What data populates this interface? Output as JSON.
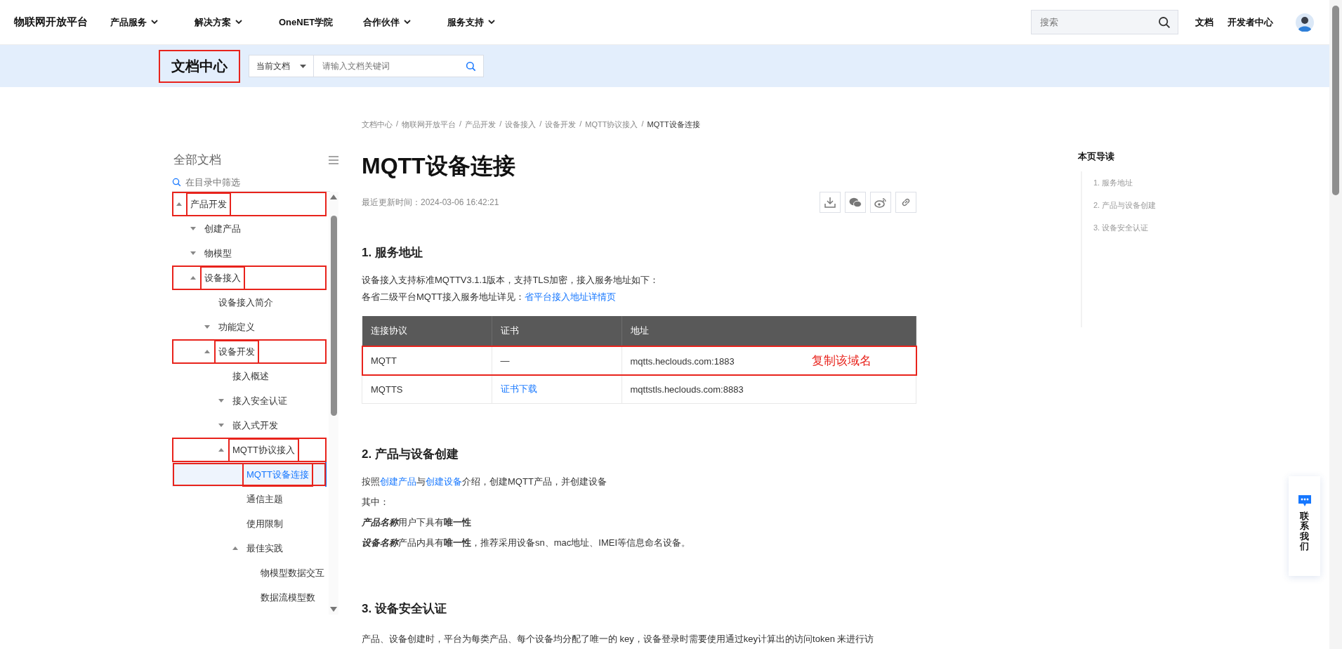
{
  "header": {
    "logo": "物联网开放平台",
    "nav": [
      {
        "label": "产品服务",
        "dropdown": true
      },
      {
        "label": "解决方案",
        "dropdown": true
      },
      {
        "label": "OneNET学院",
        "dropdown": false
      },
      {
        "label": "合作伙伴",
        "dropdown": true
      },
      {
        "label": "服务支持",
        "dropdown": true
      }
    ],
    "search": {
      "placeholder": "搜索"
    },
    "links": [
      "文档",
      "开发者中心"
    ]
  },
  "doc_bar": {
    "title": "文档中心",
    "annotated": true,
    "scope": "当前文档",
    "search": {
      "placeholder": "请输入文档关键词"
    }
  },
  "sidebar": {
    "title": "全部文档",
    "filter": {
      "placeholder": "在目录中筛选"
    },
    "tree": [
      {
        "label": "产品开发",
        "expanded": true,
        "selected": false,
        "annotated": true,
        "children": [
          {
            "label": "创建产品",
            "expanded": false,
            "selected": false,
            "annotated": false
          },
          {
            "label": "物模型",
            "expanded": false,
            "selected": false,
            "annotated": false
          },
          {
            "label": "设备接入",
            "expanded": true,
            "selected": false,
            "annotated": true,
            "children": [
              {
                "label": "设备接入简介",
                "selected": false,
                "annotated": false
              },
              {
                "label": "功能定义",
                "expanded": false,
                "selected": false,
                "annotated": false
              },
              {
                "label": "设备开发",
                "expanded": true,
                "selected": false,
                "annotated": true,
                "children": [
                  {
                    "label": "接入概述",
                    "selected": false,
                    "annotated": false
                  },
                  {
                    "label": "接入安全认证",
                    "expanded": false,
                    "selected": false,
                    "annotated": false
                  },
                  {
                    "label": "嵌入式开发",
                    "expanded": false,
                    "selected": false,
                    "annotated": false
                  },
                  {
                    "label": "MQTT协议接入",
                    "expanded": true,
                    "selected": false,
                    "annotated": true,
                    "children": [
                      {
                        "label": "MQTT设备连接",
                        "selected": true,
                        "annotated": true
                      },
                      {
                        "label": "通信主题",
                        "selected": false,
                        "annotated": false
                      },
                      {
                        "label": "使用限制",
                        "selected": false,
                        "annotated": false
                      },
                      {
                        "label": "最佳实践",
                        "expanded": true,
                        "selected": false,
                        "annotated": false,
                        "children": [
                          {
                            "label": "物模型数据交互",
                            "selected": false,
                            "annotated": false
                          },
                          {
                            "label": "数据流模型数",
                            "selected": false,
                            "annotated": false
                          }
                        ]
                      }
                    ]
                  }
                ]
              }
            ]
          }
        ]
      }
    ]
  },
  "breadcrumb_separator": "/",
  "breadcrumb": [
    "文档中心",
    "物联网开放平台",
    "产品开发",
    "设备接入",
    "设备开发",
    "MQTT协议接入",
    "MQTT设备连接"
  ],
  "article": {
    "title": "MQTT设备连接",
    "updated": "最近更新时间：2024-03-06 16:42:21",
    "sections": [
      {
        "heading": "1. 服务地址",
        "blocks": [
          {
            "kind": "para",
            "lines": [
              [
                {
                  "text": "设备接入支持标准MQTTV3.1.1版本，支持TLS加密，接入服务地址如下："
                }
              ],
              [
                {
                  "text": "各省二级平台MQTT接入服务地址详见："
                },
                {
                  "text": "省平台接入地址详情页",
                  "link": true
                }
              ]
            ]
          },
          {
            "kind": "table",
            "columns": [
              "连接协议",
              "证书",
              "地址"
            ],
            "rows": [
              {
                "cells": [
                  {
                    "text": "MQTT"
                  },
                  {
                    "text": "—"
                  },
                  {
                    "text": "mqtts.heclouds.com:1883"
                  }
                ],
                "annotated": true,
                "annotation": "复制该域名"
              },
              {
                "cells": [
                  {
                    "text": "MQTTS"
                  },
                  {
                    "text": "证书下载",
                    "link": true
                  },
                  {
                    "text": "mqttstls.heclouds.com:8883"
                  }
                ],
                "annotated": false
              }
            ]
          }
        ]
      },
      {
        "heading": "2. 产品与设备创建",
        "blocks": [
          {
            "kind": "para",
            "lines": [
              [
                {
                  "text": "按照"
                },
                {
                  "text": "创建产品",
                  "link": true
                },
                {
                  "text": "与"
                },
                {
                  "text": "创建设备",
                  "link": true
                },
                {
                  "text": "介绍，创建MQTT产品，并创建设备"
                }
              ]
            ]
          },
          {
            "kind": "para",
            "lines": [
              [
                {
                  "text": "其中："
                }
              ]
            ]
          },
          {
            "kind": "para",
            "lines": [
              [
                {
                  "text": "产品名称",
                  "emphasis": true
                },
                {
                  "text": "用户下具有**唯一性**"
                }
              ]
            ]
          },
          {
            "kind": "para",
            "lines": [
              [
                {
                  "text": "设备名称",
                  "emphasis": true
                },
                {
                  "text": "产品内具有**唯一性**，推荐采用设备sn、mac地址、IMEI等信息命名设备。"
                }
              ]
            ]
          }
        ]
      },
      {
        "heading": "3. 设备安全认证",
        "blocks": [
          {
            "kind": "para",
            "lines": [
              [
                {
                  "text": "产品、设备创建时，平台为每类产品、每个设备均分配了唯一的 key，设备登录时需要使用通过key计算出的访问token 来进行访"
                }
              ]
            ]
          }
        ]
      }
    ]
  },
  "toc": {
    "title": "本页导读",
    "items": [
      "1. 服务地址",
      "2. 产品与设备创建",
      "3. 设备安全认证"
    ]
  },
  "contact": {
    "label": "联系我们"
  }
}
